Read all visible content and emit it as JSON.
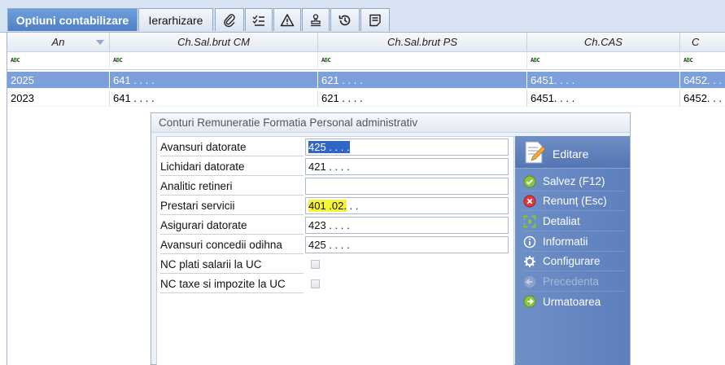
{
  "tabs": [
    {
      "label": "Optiuni contabilizare",
      "active": true
    },
    {
      "label": "Ierarhizare",
      "active": false
    }
  ],
  "tab_icons": [
    "attachment-icon",
    "checklist-icon",
    "warning-icon",
    "stamp-icon",
    "history-icon",
    "notes-icon"
  ],
  "grid": {
    "columns": [
      "An",
      "Ch.Sal.brut CM",
      "Ch.Sal.brut PS",
      "Ch.CAS",
      "C"
    ],
    "filter_glyph": "ABC",
    "rows": [
      {
        "selected": true,
        "cells": [
          "2025",
          "641 . . . .",
          "621 . . . .",
          "6451. . . .",
          "6452. . ."
        ]
      },
      {
        "selected": false,
        "cells": [
          "2023",
          "641 . . . .",
          "621 . . . .",
          "6451. . . .",
          "6452. . ."
        ]
      }
    ]
  },
  "dialog": {
    "title": "Conturi Remuneratie Formatia Personal administrativ",
    "fields": [
      {
        "label": "Avansuri datorate",
        "value": "425 . . . .",
        "type": "text",
        "state": "selected"
      },
      {
        "label": "Lichidari datorate",
        "value": "421 . . . .",
        "type": "text",
        "state": ""
      },
      {
        "label": "Analitic retineri",
        "value": "",
        "type": "text",
        "state": ""
      },
      {
        "label": "Prestari servicii",
        "value_main": "401 .02.",
        "value_rest": " . .",
        "type": "text",
        "state": "highlighted"
      },
      {
        "label": "Asigurari datorate",
        "value": "423 . . . .",
        "type": "text",
        "state": ""
      },
      {
        "label": "Avansuri concedii odihna",
        "value": "425 . . . .",
        "type": "text",
        "state": ""
      },
      {
        "label": "NC plati salarii la UC",
        "checked": false,
        "type": "checkbox"
      },
      {
        "label": "NC taxe si impozite la UC",
        "checked": false,
        "type": "checkbox"
      }
    ]
  },
  "panel": {
    "title": "Editare",
    "title_icon": "edit-document-icon",
    "items": [
      {
        "label": "Salvez (F12)",
        "icon": "save-check-icon",
        "enabled": true
      },
      {
        "label": "Renunț (Esc)",
        "icon": "cancel-x-icon",
        "enabled": true
      },
      {
        "label": "Detaliat",
        "icon": "expand-icon",
        "enabled": true
      },
      {
        "label": "Informatii",
        "icon": "info-icon",
        "enabled": true
      },
      {
        "label": "Configurare",
        "icon": "gear-icon",
        "enabled": true
      },
      {
        "label": "Precedenta",
        "icon": "arrow-left-icon",
        "enabled": false
      },
      {
        "label": "Urmatoarea",
        "icon": "arrow-right-icon",
        "enabled": true
      }
    ]
  },
  "colors": {
    "accent": "#4f80c6",
    "selected_row": "#7d9fdc",
    "panel": "#6383c0",
    "highlight": "#f5f535"
  }
}
